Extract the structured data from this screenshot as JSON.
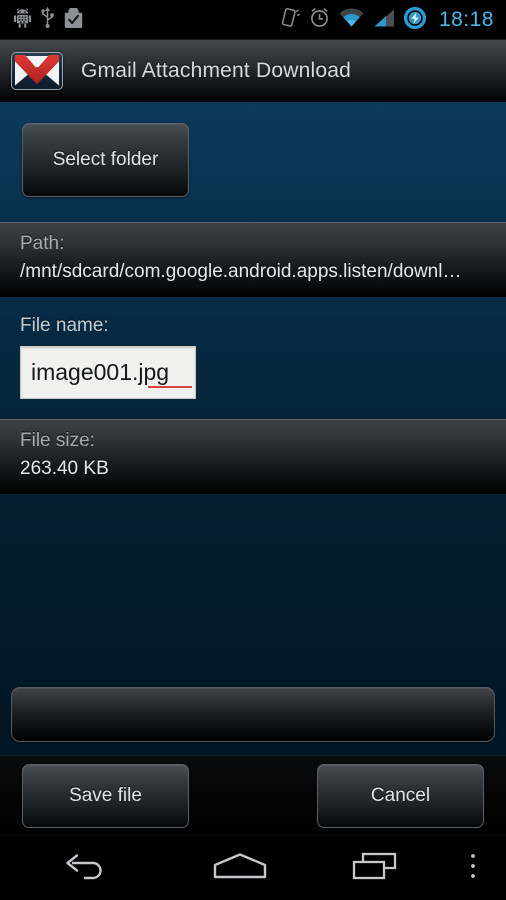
{
  "status_bar": {
    "icons_left": [
      "android-debug-icon",
      "usb-icon",
      "play-store-checkmark-icon"
    ],
    "icons_right": [
      "vibrate-mode-icon",
      "alarm-clock-icon",
      "wifi-signal-icon",
      "cellular-signal-icon",
      "battery-charging-icon"
    ],
    "clock": "18:18",
    "clock_color": "#4ab8e8"
  },
  "action_bar": {
    "app_icon": "gmail-envelope-icon",
    "title": "Gmail Attachment Download"
  },
  "content": {
    "select_folder_button": "Select folder",
    "path": {
      "label": "Path:",
      "value": "/mnt/sdcard/com.google.android.apps.listen/downl…"
    },
    "file_name": {
      "label": "File name:",
      "value": "image001.jpg",
      "spellcheck_underline": true,
      "spellcheck_color": "#d8443e"
    },
    "file_size": {
      "label": "File size:",
      "value": "263.40 KB"
    },
    "progress": {
      "percent": 0,
      "label": ""
    },
    "background_color": "#021a2b",
    "background_top_color": "#0c3a5b"
  },
  "button_bar": {
    "save_label": "Save file",
    "cancel_label": "Cancel"
  },
  "nav_bar": {
    "buttons": [
      {
        "name": "back-icon",
        "label": "Back"
      },
      {
        "name": "home-icon",
        "label": "Home"
      },
      {
        "name": "recents-icon",
        "label": "Recent apps"
      },
      {
        "name": "overflow-menu-icon",
        "label": "Menu"
      }
    ]
  }
}
